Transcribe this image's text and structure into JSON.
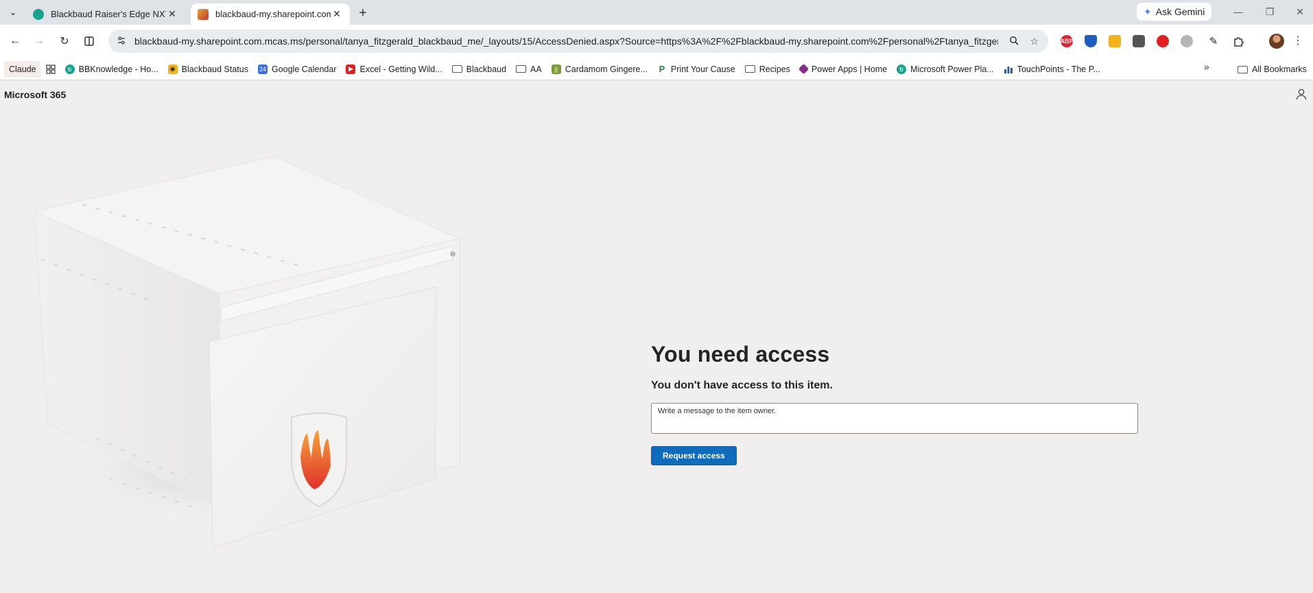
{
  "browser": {
    "tabs": [
      {
        "title": "Blackbaud Raiser's Edge NXT®",
        "favicon_color": "#1aa38c",
        "active": false
      },
      {
        "title": "blackbaud-my.sharepoint.com.mcas.ms",
        "favicon_color": "#e8a33a",
        "active": true
      }
    ],
    "ask_gemini_label": "Ask Gemini",
    "url": "blackbaud-my.sharepoint.com.mcas.ms/personal/tanya_fitzgerald_blackbaud_me/_layouts/15/AccessDenied.aspx?Source=https%3A%2F%2Fblackbaud-my.sharepoint.com%2Fpersonal%2Ftanya_fitzgeral...",
    "extensions": [
      {
        "name": "adblock-plus-icon",
        "label": "ABP",
        "color": "#e0242f"
      },
      {
        "name": "shield-extension-icon",
        "label": "",
        "color": "#1f5fbf"
      },
      {
        "name": "sticky-note-icon",
        "label": "",
        "color": "#f3b21a"
      },
      {
        "name": "grid-extension-icon",
        "label": "",
        "color": "#555555"
      },
      {
        "name": "hand-extension-icon",
        "label": "",
        "color": "#e02020"
      },
      {
        "name": "circle-extension-icon",
        "label": "",
        "color": "#9a9a9a"
      }
    ]
  },
  "bookmarks": [
    {
      "label": "Claude",
      "icon": "none",
      "color": ""
    },
    {
      "label": "",
      "icon": "apps-grid-icon",
      "color": "#444444"
    },
    {
      "label": "BBKnowledge - Ho...",
      "icon": "bb-icon",
      "color": "#1aa38c"
    },
    {
      "label": "Blackbaud Status",
      "icon": "status-icon",
      "color": "#f3b21a"
    },
    {
      "label": "Google Calendar",
      "icon": "calendar-icon",
      "color": "#3b6fe0"
    },
    {
      "label": "Excel - Getting Wild...",
      "icon": "youtube-icon",
      "color": "#e02020"
    },
    {
      "label": "Blackbaud",
      "icon": "folder-icon",
      "color": ""
    },
    {
      "label": "AA",
      "icon": "folder-icon",
      "color": ""
    },
    {
      "label": "Cardamom Gingere...",
      "icon": "recipe-icon",
      "color": "#7a9a3a"
    },
    {
      "label": "Print Your Cause",
      "icon": "p-icon",
      "color": "#2a7a4a"
    },
    {
      "label": "Recipes",
      "icon": "folder-icon",
      "color": ""
    },
    {
      "label": "Power Apps | Home",
      "icon": "powerapps-icon",
      "color": "#8a2a8a"
    },
    {
      "label": "Microsoft Power Pla...",
      "icon": "bb-icon",
      "color": "#1aa38c"
    },
    {
      "label": "TouchPoints - The P...",
      "icon": "chart-icon",
      "color": "#2a5aa0"
    }
  ],
  "bookmarks_all_label": "All Bookmarks",
  "page": {
    "brand": "Microsoft 365",
    "heading": "You need access",
    "subheading": "You don't have access to this item.",
    "message_placeholder": "Write a message to the item owner.",
    "request_button": "Request access"
  }
}
